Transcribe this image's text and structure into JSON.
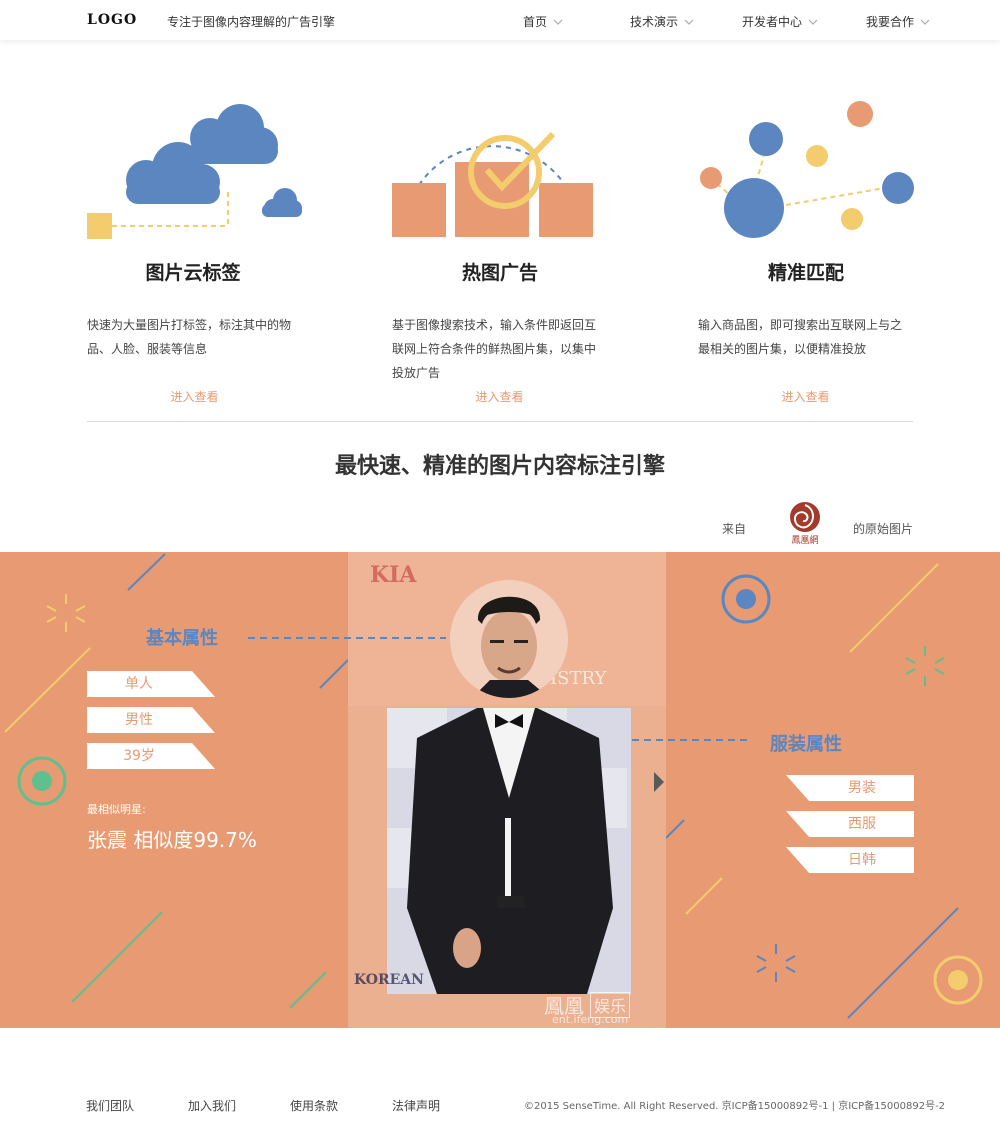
{
  "header": {
    "logo": "LOGO",
    "tagline": "专注于图像内容理解的广告引擎",
    "nav": [
      {
        "label": "首页"
      },
      {
        "label": "技术演示"
      },
      {
        "label": "开发者中心"
      },
      {
        "label": "我要合作"
      }
    ]
  },
  "features": [
    {
      "title": "图片云标签",
      "desc": "快速为大量图片打标签，标注其中的物品、人脸、服装等信息",
      "link": "进入查看"
    },
    {
      "title": "热图广告",
      "desc": "基于图像搜索技术，输入条件即返回互联网上符合条件的鲜热图片集，以集中投放广告",
      "link": "进入查看"
    },
    {
      "title": "精准匹配",
      "desc": "输入商品图，即可搜索出互联网上与之最相关的图片集，以便精准投放",
      "link": "进入查看"
    }
  ],
  "main_heading": "最快速、精准的图片内容标注引擎",
  "source": {
    "prefix": "来自",
    "logo_text": "鳳凰網",
    "suffix": "的原始图片"
  },
  "demo": {
    "basic_title": "基本属性",
    "basic_tags": [
      "单人",
      "男性",
      "39岁"
    ],
    "star_label": "最相似明星:",
    "star_value": "张震 相似度99.7%",
    "clothing_title": "服装属性",
    "clothing_tags": [
      "男装",
      "西服",
      "日韩"
    ],
    "watermarks": {
      "kia": "KIA",
      "tistry": "TISTRY",
      "korean": "KOREAN",
      "ifeng": "鳳凰",
      "ent": "娱乐",
      "ent_url": "ent.ifeng.com"
    }
  },
  "footer": {
    "links": [
      "我们团队",
      "加入我们",
      "使用条款",
      "法律声明"
    ],
    "copyright": "©2015 SenseTime. All Right Reserved. 京ICP备15000892号-1 | 京ICP备15000892号-2"
  },
  "colors": {
    "accent": "#e89a72",
    "blue": "#5b86c0",
    "yellow": "#f3cc6d"
  }
}
